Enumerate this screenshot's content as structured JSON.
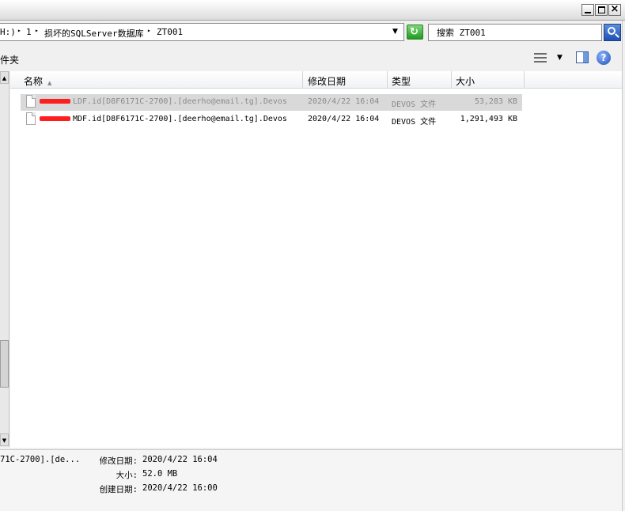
{
  "window": {
    "minimize_icon": "minimize-icon",
    "maximize_icon": "maximize-icon",
    "close_icon": "close-icon"
  },
  "address": {
    "crumbs": [
      "H:)",
      "1",
      "损坏的SQLServer数据库",
      "ZT001"
    ],
    "arrow_glyph": "▸",
    "dropdown_glyph": "▼",
    "refresh_icon": "refresh-icon"
  },
  "search": {
    "value": "搜索 ZT001",
    "icon": "search-icon"
  },
  "toolbar": {
    "organize_label": "件夹",
    "view_icon": "view-icon",
    "view_dropdown_glyph": "▼",
    "preview_icon": "preview-pane-icon",
    "help_label": "?"
  },
  "columns": {
    "name": "名称",
    "date": "修改日期",
    "type": "类型",
    "size": "大小",
    "sort_glyph": "▲"
  },
  "files": [
    {
      "name": "LDF.id[D8F6171C-2700].[deerho@email.tg].Devos",
      "date": "2020/4/22 16:04",
      "type": "DEVOS 文件",
      "size": "53,283 KB",
      "selected": true
    },
    {
      "name": "MDF.id[D8F6171C-2700].[deerho@email.tg].Devos",
      "date": "2020/4/22 16:04",
      "type": "DEVOS 文件",
      "size": "1,291,493 KB",
      "selected": false
    }
  ],
  "details": {
    "filename": "71C-2700].[de...",
    "modified_label": "修改日期:",
    "modified_value": "2020/4/22 16:04",
    "size_label": "大小:",
    "size_value": "52.0 MB",
    "created_label": "创建日期:",
    "created_value": "2020/4/22 16:00"
  },
  "colors": {
    "redaction": "#ff1e1e",
    "selection": "#d9d9d9",
    "refresh": "#1e9c1e"
  }
}
